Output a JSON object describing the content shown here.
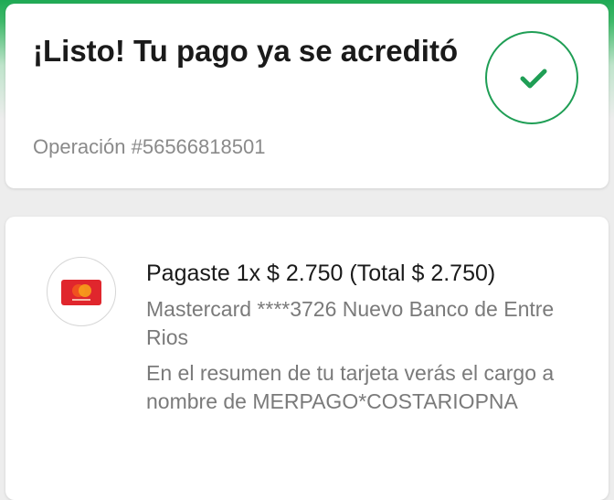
{
  "success": {
    "title": "¡Listo! Tu pago ya se acreditó",
    "operation": "Operación #56566818501",
    "icon": "check-icon"
  },
  "payment": {
    "card_icon": "mastercard-icon",
    "summary": "Pagaste 1x $ 2.750 (Total $ 2.750)",
    "card_detail": "Mastercard ****3726 Nuevo Banco de Entre Rios",
    "statement_note": "En el resumen de tu tarjeta verás el cargo a nombre de MERPAGO*COSTARIOPNA"
  },
  "colors": {
    "brand_green": "#1f9e55",
    "card_red": "#e0262d",
    "card_orange": "#f79e1b"
  }
}
